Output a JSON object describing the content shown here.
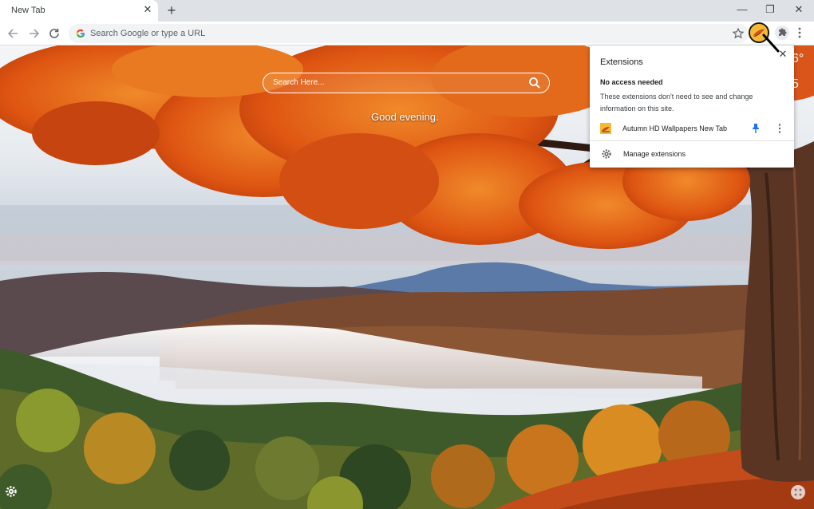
{
  "tab": {
    "title": "New Tab",
    "close": "✕",
    "new": "+"
  },
  "window": {
    "minimize": "—",
    "restore": "❐",
    "close": "✕"
  },
  "toolbar": {
    "back_icon": "arrow-left-icon",
    "forward_icon": "arrow-right-icon",
    "reload_icon": "reload-icon",
    "omnibox_placeholder": "Search Google or type a URL",
    "bookmark_icon": "star-icon",
    "active_extension_icon": "autumn-leaf-icon",
    "extensions_icon": "puzzle-icon",
    "menu_icon": "kebab-icon"
  },
  "newtab": {
    "search_placeholder": "Search Here...",
    "greeting": "Good evening.",
    "weather_top": "6°",
    "weather_bottom": "5"
  },
  "extensions_popup": {
    "title": "Extensions",
    "close": "✕",
    "section_title": "No access needed",
    "section_desc": "These extensions don't need to see and change information on this site.",
    "items": [
      {
        "name": "Autumn HD Wallpapers New Tab",
        "pinned": true
      }
    ],
    "manage_label": "Manage extensions"
  },
  "colors": {
    "accent": "#1a73e8",
    "chrome_bg": "#dee1e6",
    "orange_leaves": "#e05a14"
  }
}
